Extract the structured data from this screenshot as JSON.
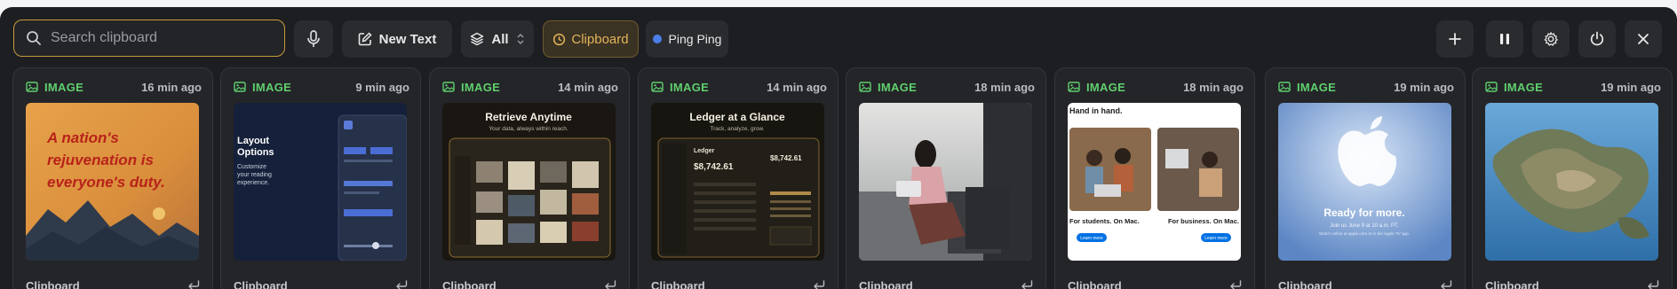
{
  "search": {
    "placeholder": "Search clipboard"
  },
  "toolbar": {
    "new_text_label": "New Text",
    "filter_label": "All",
    "category_label": "Clipboard",
    "device_label": "Ping Ping"
  },
  "colors": {
    "accent": "#c89b3c",
    "type_green": "#5fcf6e",
    "device_dot": "#4a7fe8",
    "panel_bg": "#1d1e21"
  },
  "cards": [
    {
      "type": "IMAGE",
      "time": "16 min ago",
      "source": "Clipboard",
      "thumb": {
        "line1": "A nation's",
        "line2": "rejuvenation is",
        "line3": "everyone's duty."
      }
    },
    {
      "type": "IMAGE",
      "time": "9 min ago",
      "source": "Clipboard",
      "thumb": {
        "title": "Layout",
        "title2": "Options",
        "sub1": "Customize",
        "sub2": "your reading",
        "sub3": "experience."
      }
    },
    {
      "type": "IMAGE",
      "time": "14 min ago",
      "source": "Clipboard",
      "thumb": {
        "title": "Retrieve Anytime",
        "sub": "Your data, always within reach."
      }
    },
    {
      "type": "IMAGE",
      "time": "14 min ago",
      "source": "Clipboard",
      "thumb": {
        "title": "Ledger at a Glance",
        "sub": "Track, analyze, grow.",
        "panel_title": "Ledger",
        "amount": "$8,742.61",
        "amount2": "$8,742.61"
      }
    },
    {
      "type": "IMAGE",
      "time": "18 min ago",
      "source": "Clipboard",
      "thumb": {}
    },
    {
      "type": "IMAGE",
      "time": "18 min ago",
      "source": "Clipboard",
      "thumb": {
        "title": "Hand in hand.",
        "cap1": "For students. On Mac.",
        "cap2": "For business. On Mac.",
        "btn": "Learn more"
      }
    },
    {
      "type": "IMAGE",
      "time": "19 min ago",
      "source": "Clipboard",
      "thumb": {
        "title": "Ready for more.",
        "sub1": "Join us June 9 at 10 a.m. PT.",
        "sub2": "Watch online at apple.com or in the Apple TV app."
      }
    },
    {
      "type": "IMAGE",
      "time": "19 min ago",
      "source": "Clipboard",
      "thumb": {}
    }
  ]
}
